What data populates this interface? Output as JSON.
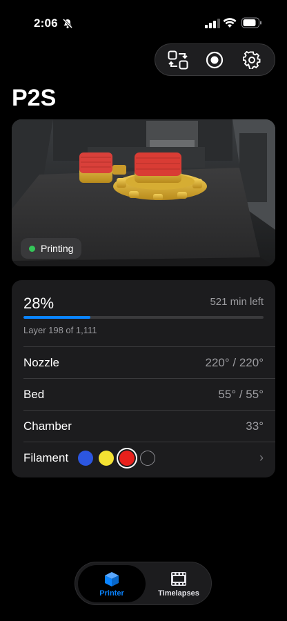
{
  "status_bar": {
    "time": "2:06"
  },
  "toolbar": {
    "swap_icon": "swap-camera-icon",
    "record_icon": "record-icon",
    "settings_icon": "gear-icon"
  },
  "printer_name": "P2S",
  "camera": {
    "status_label": "Printing",
    "status_color": "#34c759"
  },
  "progress": {
    "percent_label": "28%",
    "percent_value": 28,
    "time_left": "521 min left",
    "layer_text": "Layer 198 of 1,111"
  },
  "rows": {
    "nozzle": {
      "label": "Nozzle",
      "value": "220° / 220°"
    },
    "bed": {
      "label": "Bed",
      "value": "55° / 55°"
    },
    "chamber": {
      "label": "Chamber",
      "value": "33°"
    },
    "filament": {
      "label": "Filament",
      "colors": [
        "#2c56e0",
        "#f4e233",
        "#e8201c",
        "empty"
      ],
      "selected_index": 2
    }
  },
  "tabs": {
    "printer": "Printer",
    "timelapses": "Timelapses"
  },
  "colors": {
    "accent": "#0a84ff",
    "background": "#000000",
    "card": "#1c1c1e"
  }
}
